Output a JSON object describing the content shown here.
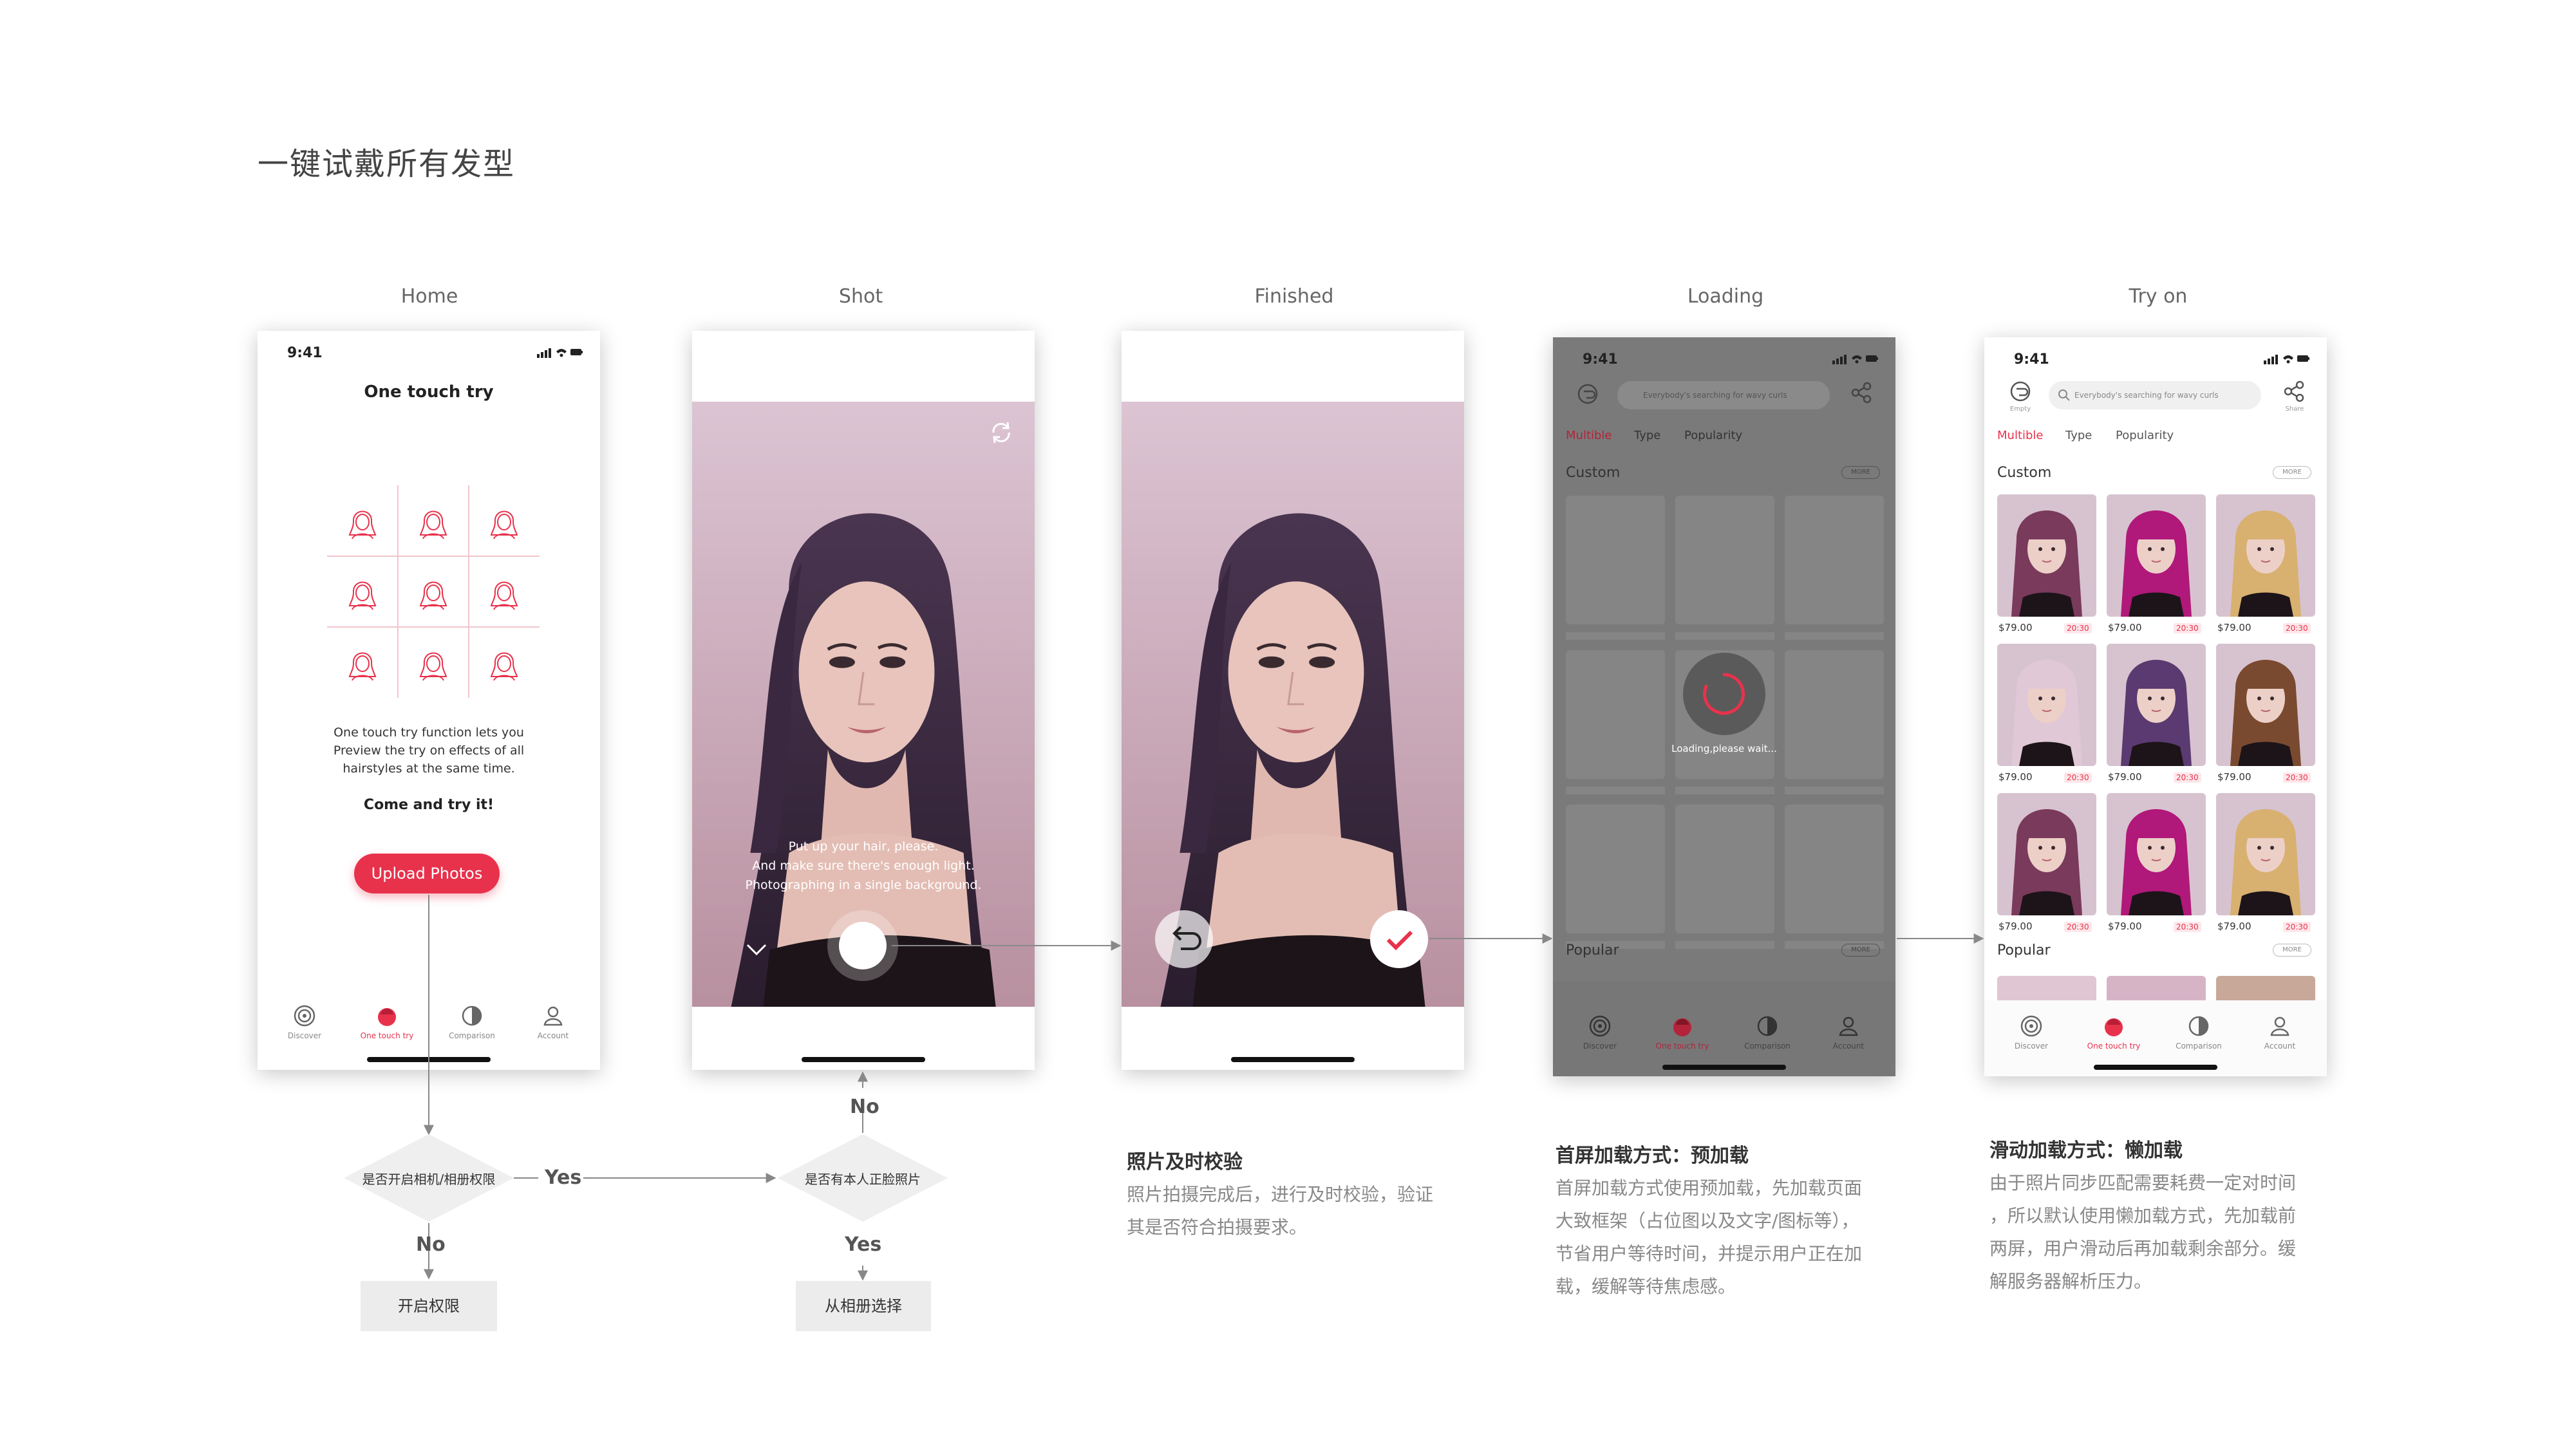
{
  "page_title": "一键试戴所有发型",
  "screens": {
    "home": "Home",
    "shot": "Shot",
    "finished": "Finished",
    "loading": "Loading",
    "tryon": "Try on"
  },
  "status_time": "9:41",
  "home": {
    "title": "One touch try",
    "desc_line1": "One touch try function lets you",
    "desc_line2": "Preview the try on effects of all",
    "desc_line3": "hairstyles at the same time.",
    "cta_text": "Come and try it!",
    "upload_button": "Upload Photos"
  },
  "tabs": {
    "discover": "Discover",
    "one_touch": "One touch try",
    "comparison": "Comparison",
    "account": "Account"
  },
  "shot": {
    "hint_line1": "Put up your hair, please.",
    "hint_line2": "And make sure there's enough light.",
    "hint_line3": "Photographing in a single background."
  },
  "loading": {
    "loading_text": "Loading,please wait..."
  },
  "tryon": {
    "empty_label": "Empty",
    "share_label": "Share",
    "search_placeholder": "Everybody's searching for wavy curls",
    "seg_multiple": "Multible",
    "seg_type": "Type",
    "seg_popularity": "Popularity",
    "section_custom": "Custom",
    "section_popular": "Popular",
    "more": "MORE",
    "cards": [
      {
        "price": "$79.00",
        "badge": "20:30"
      },
      {
        "price": "$79.00",
        "badge": "20:30"
      },
      {
        "price": "$79.00",
        "badge": "20:30"
      },
      {
        "price": "$79.00",
        "badge": "20:30"
      },
      {
        "price": "$79.00",
        "badge": "20:30"
      },
      {
        "price": "$79.00",
        "badge": "20:30"
      },
      {
        "price": "$79.00",
        "badge": "20:30"
      },
      {
        "price": "$79.00",
        "badge": "20:30"
      },
      {
        "price": "$79.00",
        "badge": "20:30"
      }
    ]
  },
  "flow": {
    "q1": "是否开启相机/相册权限",
    "q1_yes": "Yes",
    "q1_no": "No",
    "action1": "开启权限",
    "q2": "是否有本人正脸照片",
    "q2_no": "No",
    "q2_yes": "Yes",
    "action2": "从相册选择"
  },
  "notes": {
    "finished_title": "照片及时校验",
    "finished_line1": "照片拍摄完成后，进行及时校验，验证",
    "finished_line2": "其是否符合拍摄要求。",
    "loading_title": "首屏加载方式：预加载",
    "loading_line1": "首屏加载方式使用预加载，先加载页面",
    "loading_line2": "大致框架（占位图以及文字/图标等），",
    "loading_line3": "节省用户等待时间，并提示用户正在加",
    "loading_line4": "载，缓解等待焦虑感。",
    "tryon_title": "滑动加载方式：懒加载",
    "tryon_line1": "由于照片同步匹配需要耗费一定对时间",
    "tryon_line2": "，所以默认使用懒加载方式，先加载前",
    "tryon_line3": "两屏，用户滑动后再加载剩余部分。缓",
    "tryon_line4": "解服务器解析压力。"
  },
  "colors": {
    "accent": "#e8324c",
    "overlay": "#7a7a7a",
    "skin_bg": "#cdb0c1"
  }
}
